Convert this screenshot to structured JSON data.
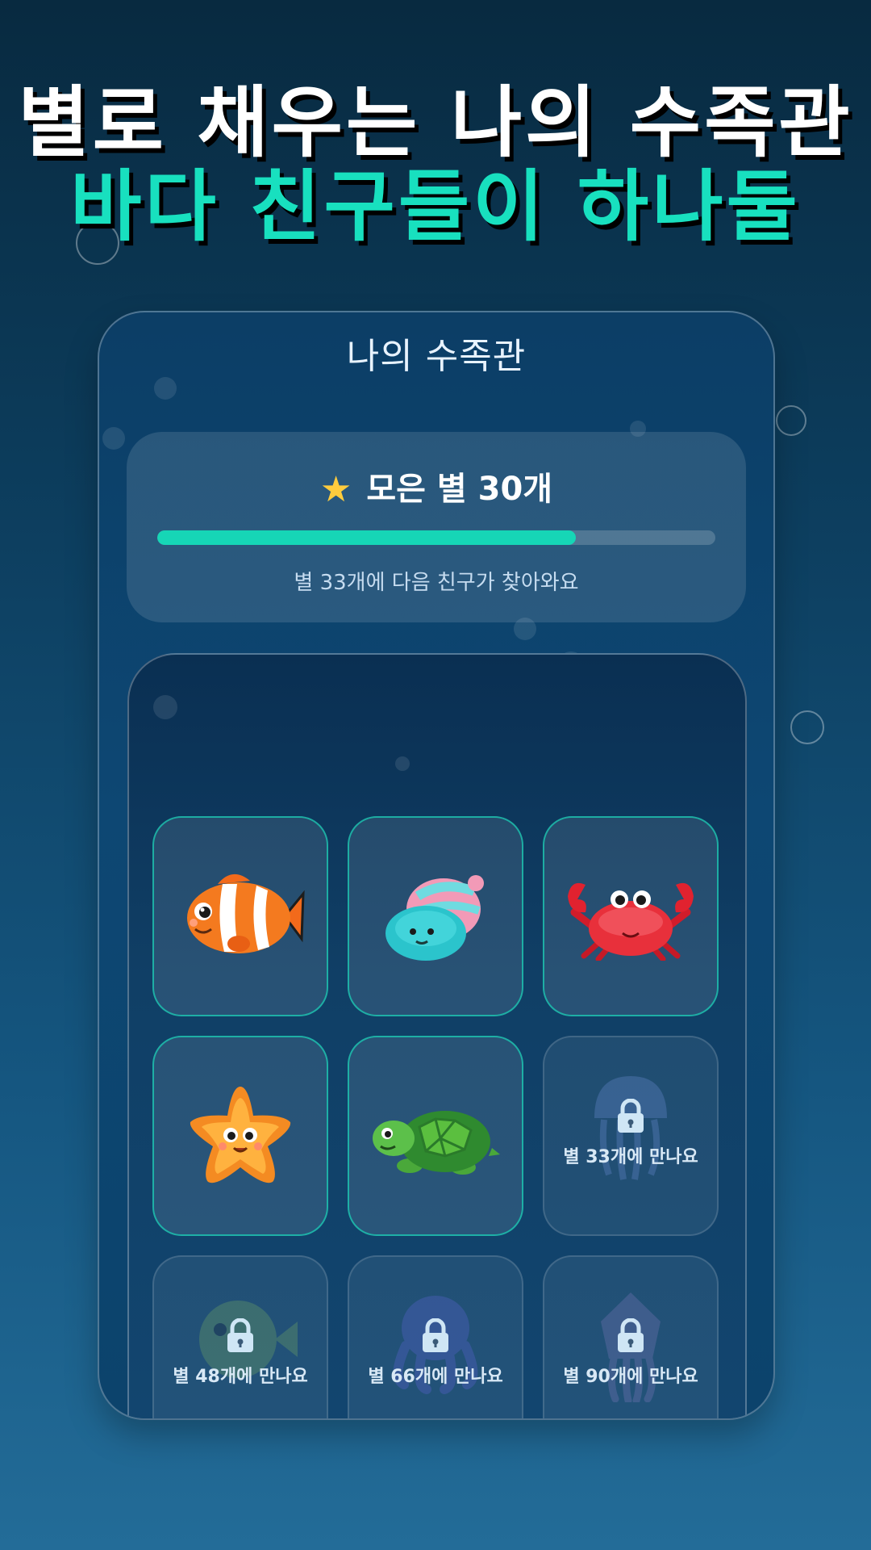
{
  "headline": {
    "line1": "별로 채우는 나의 수족관",
    "line2": "바다 친구들이 하나둘"
  },
  "app": {
    "title": "나의 수족관",
    "stars": {
      "icon": "star-icon",
      "label": "모은 별 30개",
      "progress_fraction": 0.75,
      "next_text": "별 33개에 다음 친구가 찾아와요"
    }
  },
  "colors": {
    "accent": "#18e0bf",
    "star": "#ffcc3d",
    "background_top": "#082a40",
    "background_bottom": "#236c98"
  },
  "friends": [
    {
      "name": "clownfish",
      "icon": "clownfish-icon",
      "locked": false
    },
    {
      "name": "hermit-snail",
      "icon": "snail-icon",
      "locked": false
    },
    {
      "name": "crab",
      "icon": "crab-icon",
      "locked": false
    },
    {
      "name": "starfish",
      "icon": "starfish-icon",
      "locked": false
    },
    {
      "name": "turtle",
      "icon": "turtle-icon",
      "locked": false
    },
    {
      "name": "jellyfish",
      "icon": "jellyfish-icon",
      "locked": true,
      "unlock_text": "별 33개에 만나요"
    },
    {
      "name": "pufferfish",
      "icon": "pufferfish-icon",
      "locked": true,
      "unlock_text": "별 48개에 만나요"
    },
    {
      "name": "octopus",
      "icon": "octopus-icon",
      "locked": true,
      "unlock_text": "별 66개에 만나요"
    },
    {
      "name": "squid",
      "icon": "squid-icon",
      "locked": true,
      "unlock_text": "별 90개에 만나요"
    }
  ]
}
